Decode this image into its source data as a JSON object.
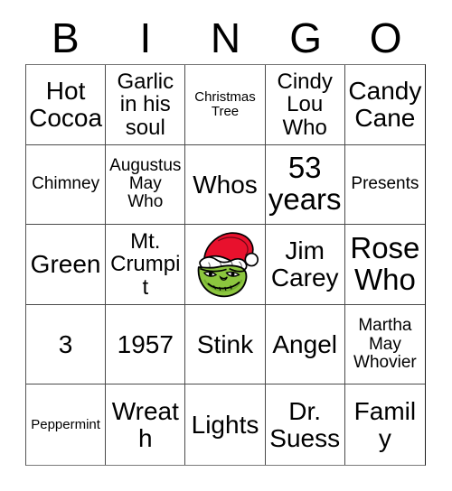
{
  "card": {
    "type": "bingo-card",
    "title_letters": [
      "B",
      "I",
      "N",
      "G",
      "O"
    ],
    "columns": 5,
    "rows": 5,
    "colors": {
      "background": "#ffffff",
      "text": "#000000",
      "grid_line": "#4a4a4a",
      "grinch_skin": "#8cc63e",
      "grinch_skin_dark": "#6aa32c",
      "santa_hat_red": "#e8112d",
      "santa_hat_white": "#ffffff",
      "outline": "#000000"
    },
    "cells": [
      {
        "text": "Hot\nCocoa",
        "size": "lg",
        "row": 1,
        "col": 1,
        "column_letter": "B"
      },
      {
        "text": "Garlic\nin his\nsoul",
        "size": "md",
        "row": 1,
        "col": 2,
        "column_letter": "I"
      },
      {
        "text": "Christmas\nTree",
        "size": "xs",
        "row": 1,
        "col": 3,
        "column_letter": "N"
      },
      {
        "text": "Cindy\nLou\nWho",
        "size": "md",
        "row": 1,
        "col": 4,
        "column_letter": "G"
      },
      {
        "text": "Candy\nCane",
        "size": "lg",
        "row": 1,
        "col": 5,
        "column_letter": "O"
      },
      {
        "text": "Chimney",
        "size": "sm",
        "row": 2,
        "col": 1,
        "column_letter": "B"
      },
      {
        "text": "Augustus\nMay\nWho",
        "size": "sm",
        "row": 2,
        "col": 2,
        "column_letter": "I"
      },
      {
        "text": "Whos",
        "size": "lg",
        "row": 2,
        "col": 3,
        "column_letter": "N"
      },
      {
        "text": "53\nyears",
        "size": "xl",
        "row": 2,
        "col": 4,
        "column_letter": "G"
      },
      {
        "text": "Presents",
        "size": "sm",
        "row": 2,
        "col": 5,
        "column_letter": "O"
      },
      {
        "text": "Green",
        "size": "lg",
        "row": 3,
        "col": 1,
        "column_letter": "B"
      },
      {
        "text": "Mt.\nCrumpit",
        "size": "md",
        "row": 3,
        "col": 2,
        "column_letter": "I"
      },
      {
        "text": "",
        "size": "md",
        "row": 3,
        "col": 3,
        "column_letter": "N",
        "image": "grinch-santa-hat"
      },
      {
        "text": "Jim\nCarey",
        "size": "lg",
        "row": 3,
        "col": 4,
        "column_letter": "G"
      },
      {
        "text": "Rose\nWho",
        "size": "xl",
        "row": 3,
        "col": 5,
        "column_letter": "O"
      },
      {
        "text": "3",
        "size": "lg",
        "row": 4,
        "col": 1,
        "column_letter": "B"
      },
      {
        "text": "1957",
        "size": "lg",
        "row": 4,
        "col": 2,
        "column_letter": "I"
      },
      {
        "text": "Stink",
        "size": "lg",
        "row": 4,
        "col": 3,
        "column_letter": "N"
      },
      {
        "text": "Angel",
        "size": "lg",
        "row": 4,
        "col": 4,
        "column_letter": "G"
      },
      {
        "text": "Martha\nMay\nWhovier",
        "size": "sm",
        "row": 4,
        "col": 5,
        "column_letter": "O"
      },
      {
        "text": "Peppermint",
        "size": "xs",
        "row": 5,
        "col": 1,
        "column_letter": "B"
      },
      {
        "text": "Wreath",
        "size": "lg",
        "row": 5,
        "col": 2,
        "column_letter": "I"
      },
      {
        "text": "Lights",
        "size": "lg",
        "row": 5,
        "col": 3,
        "column_letter": "N"
      },
      {
        "text": "Dr.\nSuess",
        "size": "lg",
        "row": 5,
        "col": 4,
        "column_letter": "G"
      },
      {
        "text": "Family",
        "size": "lg",
        "row": 5,
        "col": 5,
        "column_letter": "O"
      }
    ]
  }
}
